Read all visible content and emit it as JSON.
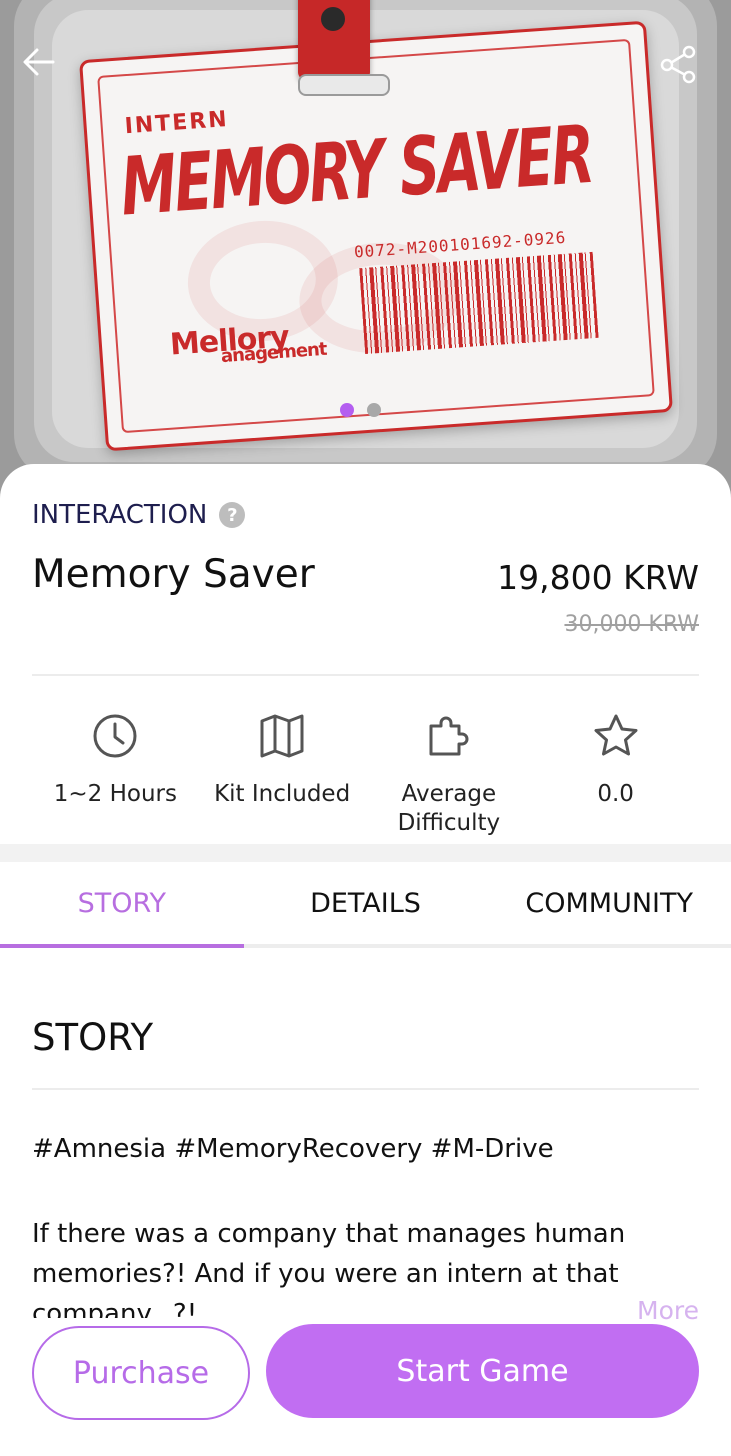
{
  "hero": {
    "card": {
      "intern_label": "INTERN",
      "title": "MEMORY SAVER",
      "code": "0072-M200101692-0926",
      "logo_line1": "Mellory",
      "logo_line2": "anagement"
    },
    "carousel": {
      "count": 2,
      "active_index": 0
    },
    "back_icon": "arrow-left-icon",
    "share_icon": "share-icon"
  },
  "info": {
    "type_label": "INTERACTION",
    "help_icon": "?",
    "title": "Memory Saver",
    "price": "19,800 KRW",
    "original_price": "30,000 KRW"
  },
  "features": [
    {
      "icon": "clock-icon",
      "label": "1~2 Hours"
    },
    {
      "icon": "map-icon",
      "label": "Kit Included"
    },
    {
      "icon": "puzzle-icon",
      "label": "Average\nDifficulty"
    },
    {
      "icon": "star-icon",
      "label": "0.0"
    }
  ],
  "tabs": [
    {
      "label": "STORY",
      "active": true
    },
    {
      "label": "DETAILS",
      "active": false
    },
    {
      "label": "COMMUNITY",
      "active": false
    }
  ],
  "story": {
    "heading": "STORY",
    "hashtags": "#Amnesia #MemoryRecovery #M-Drive",
    "text": "If there was a company that manages human memories?! And if you were an intern at that company...?!",
    "more_label": "More"
  },
  "actions": {
    "purchase_label": "Purchase",
    "start_label": "Start Game"
  },
  "colors": {
    "accent": "#c16ef2",
    "tab_active": "#b76ee0",
    "type_label": "#1e1e4e",
    "card_red": "#c92a2a"
  }
}
